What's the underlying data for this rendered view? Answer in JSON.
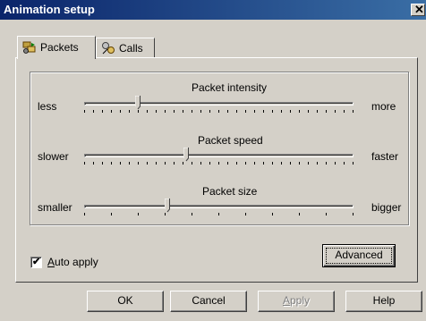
{
  "window": {
    "title": "Animation setup",
    "close_glyph": "✕"
  },
  "tabs": [
    {
      "label": "Packets",
      "icon": "packets-icon",
      "active": true
    },
    {
      "label": "Calls",
      "icon": "calls-icon",
      "active": false
    }
  ],
  "sliders": [
    {
      "title": "Packet intensity",
      "min_label": "less",
      "max_label": "more",
      "ticks": 31,
      "value_fraction": 0.2
    },
    {
      "title": "Packet speed",
      "min_label": "slower",
      "max_label": "faster",
      "ticks": 31,
      "value_fraction": 0.38
    },
    {
      "title": "Packet size",
      "min_label": "smaller",
      "max_label": "bigger",
      "ticks": 11,
      "value_fraction": 0.31
    }
  ],
  "auto_apply": {
    "label_first": "A",
    "label_rest": "uto apply",
    "checked": true,
    "check_glyph": "✔"
  },
  "advanced_button": {
    "label": "Advanced"
  },
  "buttons": {
    "ok": "OK",
    "cancel": "Cancel",
    "apply_first": "A",
    "apply_rest": "pply",
    "help": "Help"
  },
  "colors": {
    "title_bar": "#0a246a",
    "face": "#d4d0c8"
  }
}
